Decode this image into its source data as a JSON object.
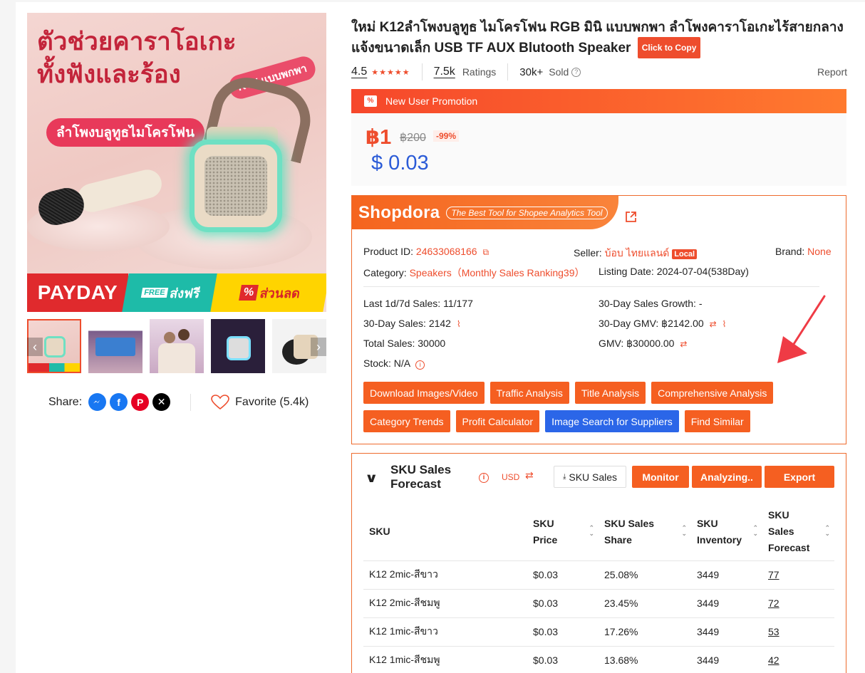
{
  "product": {
    "title": "ใหม่ K12ลำโพงบลูทูธ ไมโครโฟน RGB มินิ แบบพกพา ลำโพงคาราโอเกะไร้สายกลางแจ้งขนาดเล็ก USB TF AUX Blutooth Speaker",
    "copy_label": "Click to Copy",
    "rating": "4.5",
    "ratings_count": "7.5k",
    "ratings_label": "Ratings",
    "sold_count": "30k+",
    "sold_label": "Sold",
    "report_label": "Report"
  },
  "hero": {
    "headline_1": "ตัวช่วยคาราโอเกะ",
    "headline_2": "ทั้งฟังและร้อง",
    "sub": "ลำโพงบลูทูธไมโครโฟน",
    "badge": "KTV แบบพกพา",
    "payday": "PAYDAY",
    "free_tag": "FREE",
    "free_text": "ส่งฟรี",
    "discount_icon": "%",
    "discount_text": "ส่วนลด"
  },
  "thumbnails": [
    "thumb-1",
    "thumb-2",
    "thumb-3",
    "thumb-4",
    "thumb-5"
  ],
  "share": {
    "label": "Share:",
    "favorite": "Favorite (5.4k)"
  },
  "promotion": {
    "banner": "New User Promotion",
    "price": "฿1",
    "old_price": "฿200",
    "discount": "-99%",
    "usd_price": "$ 0.03"
  },
  "shopdora": {
    "logo": "Shopdora",
    "tagline": "The Best Tool for Shopee Analytics Tool",
    "product_id_label": "Product ID:",
    "product_id": "24633068166",
    "seller_label": "Seller:",
    "seller": "บ้อบ ไทยแลนด์",
    "local": "Local",
    "brand_label": "Brand:",
    "brand": "None",
    "category_label": "Category:",
    "category": "Speakers（Monthly Sales Ranking39）",
    "listing_label": "Listing Date:",
    "listing": "2024-07-04(538Day)",
    "stats": {
      "last_sales": "Last 1d/7d Sales: 11/177",
      "growth": "30-Day Sales Growth: -",
      "sales_30": "30-Day Sales: 2142",
      "gmv_30": "30-Day GMV: ฿2142.00",
      "total_sales": "Total Sales: 30000",
      "gmv": "GMV: ฿30000.00",
      "stock": "Stock: N/A"
    },
    "buttons_row1": [
      "Download Images/Video",
      "Traffic Analysis",
      "Title Analysis",
      "Comprehensive Analysis"
    ],
    "buttons_row2": [
      "Category Trends",
      "Profit Calculator",
      "Image Search for Suppliers",
      "Find Similar"
    ]
  },
  "sku": {
    "title_1": "SKU Sales",
    "title_2": "Forecast",
    "currency": "USD",
    "sku_sales_btn": "SKU Sales",
    "monitor_btn": "Monitor",
    "analyzing_btn": "Analyzing..",
    "export_btn": "Export",
    "headers": {
      "sku": "SKU",
      "price_1": "SKU",
      "price_2": "Price",
      "share_1": "SKU Sales",
      "share_2": "Share",
      "inv_1": "SKU",
      "inv_2": "Inventory",
      "fc_1": "SKU",
      "fc_2": "Sales",
      "fc_3": "Forecast"
    },
    "rows": [
      {
        "name": "K12 2mic-สีขาว",
        "price": "$0.03",
        "share": "25.08%",
        "inventory": "3449",
        "forecast": "77"
      },
      {
        "name": "K12 2mic-สีชมพู",
        "price": "$0.03",
        "share": "23.45%",
        "inventory": "3449",
        "forecast": "72"
      },
      {
        "name": "K12 1mic-สีขาว",
        "price": "$0.03",
        "share": "17.26%",
        "inventory": "3449",
        "forecast": "53"
      },
      {
        "name": "K12 1mic-สีชมพู",
        "price": "$0.03",
        "share": "13.68%",
        "inventory": "3449",
        "forecast": "42"
      }
    ]
  },
  "colors": {
    "accent": "#ee4d2d",
    "blue": "#2b66e8",
    "usd": "#2b5bd7"
  }
}
